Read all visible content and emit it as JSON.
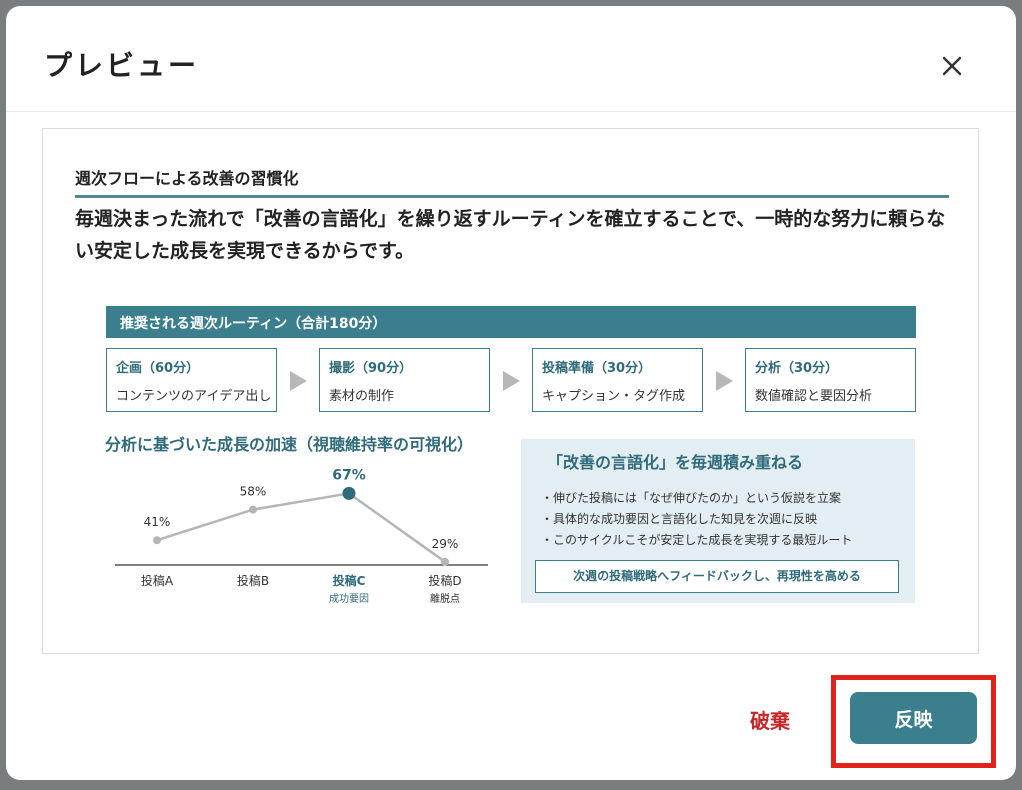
{
  "modal": {
    "title": "プレビュー",
    "close_icon": "close-icon"
  },
  "preview": {
    "section_title": "週次フローによる改善の習慣化",
    "lead": "毎週決まった流れで「改善の言語化」を繰り返すルーティンを確立することで、一時的な努力に頼らない安定した成長を実現できるからです。",
    "routine": {
      "title": "推奨される週次ルーティン（合計180分）",
      "steps": [
        {
          "head": "企画（60分）",
          "body": "コンテンツのアイデア出し"
        },
        {
          "head": "撮影（90分）",
          "body": "素材の制作"
        },
        {
          "head": "投稿準備（30分）",
          "body": "キャプション・タグ作成"
        },
        {
          "head": "分析（30分）",
          "body": "数値確認と要因分析"
        }
      ]
    },
    "verbalize": {
      "title": "「改善の言語化」を毎週積み重ねる",
      "bullets": [
        "伸びた投稿には「なぜ伸びたのか」という仮説を立案",
        "具体的な成功要因と言語化した知見を次週に反映",
        "このサイクルこそが安定した成長を実現する最短ルート"
      ],
      "footer": "次週の投稿戦略へフィードバックし、再現性を高める"
    }
  },
  "chart_data": {
    "type": "line",
    "title": "分析に基づいた成長の加速（視聴維持率の可視化）",
    "categories": [
      "投稿A",
      "投稿B",
      "投稿C",
      "投稿D"
    ],
    "sublabels": [
      "",
      "",
      "成功要因",
      "離脱点"
    ],
    "value_labels": [
      "41%",
      "58%",
      "67%",
      "29%"
    ],
    "values": [
      41,
      58,
      67,
      29
    ],
    "highlight_index": 2,
    "ylim": [
      0,
      100
    ],
    "colors": {
      "line": "#b5b5b5",
      "highlight": "#2f6b7a",
      "text": "#333333"
    }
  },
  "actions": {
    "discard": "破棄",
    "apply": "反映"
  },
  "colors": {
    "accent": "#3b7f8e",
    "danger": "#c62828",
    "highlight_frame": "#e0231b"
  }
}
